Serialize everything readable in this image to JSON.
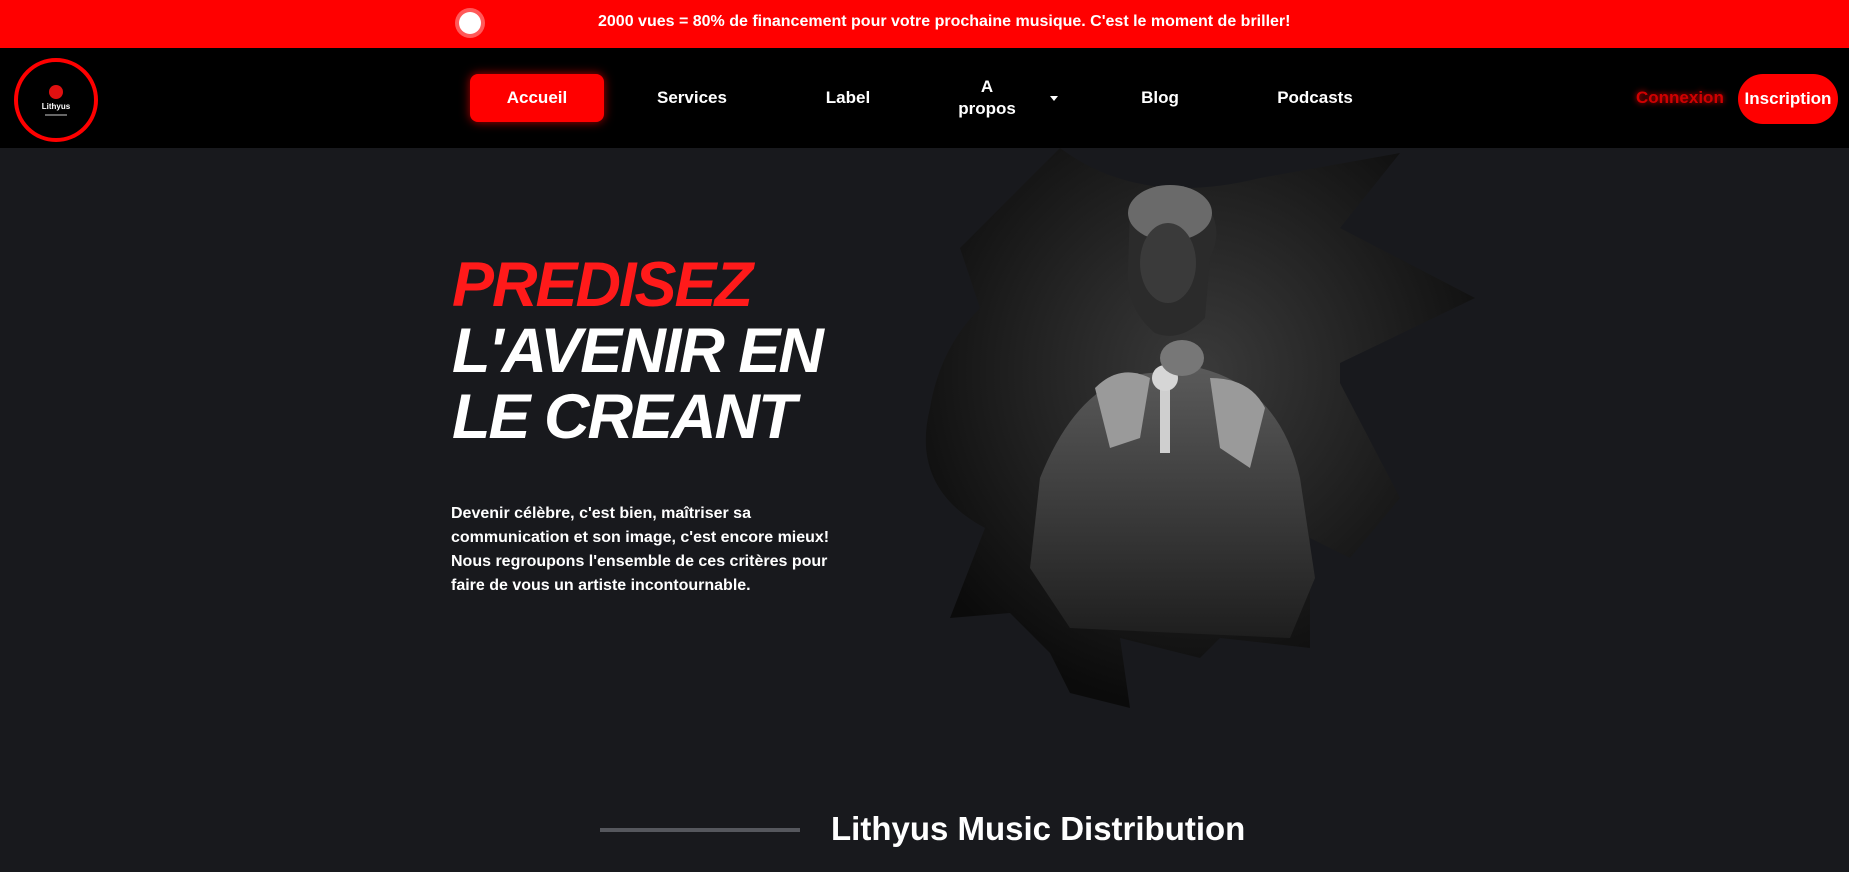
{
  "promo": {
    "text": "2000 vues = 80% de financement pour votre prochaine musique. C'est le moment de briller!"
  },
  "logo": {
    "text": "Lithyus"
  },
  "nav": {
    "items": [
      {
        "label": "Accueil",
        "active": true
      },
      {
        "label": "Services"
      },
      {
        "label": "Label"
      },
      {
        "label": "A propos",
        "has_dropdown": true
      },
      {
        "label": "Blog"
      },
      {
        "label": "Podcasts"
      }
    ],
    "login_label": "Connexion",
    "signup_label": "Inscription"
  },
  "hero": {
    "title_red": "PREDISEZ",
    "title_line2": "L'AVENIR EN",
    "title_line3": "LE CREANT",
    "text": "Devenir célèbre, c'est bien, maîtriser sa communication et son image, c'est encore mieux! Nous regroupons l'ensemble de ces critères pour faire de vous un artiste incontournable."
  },
  "section": {
    "title": "Lithyus Music Distribution"
  },
  "colors": {
    "accent": "#ff0000",
    "background": "#18191d",
    "nav_background": "#000000"
  }
}
